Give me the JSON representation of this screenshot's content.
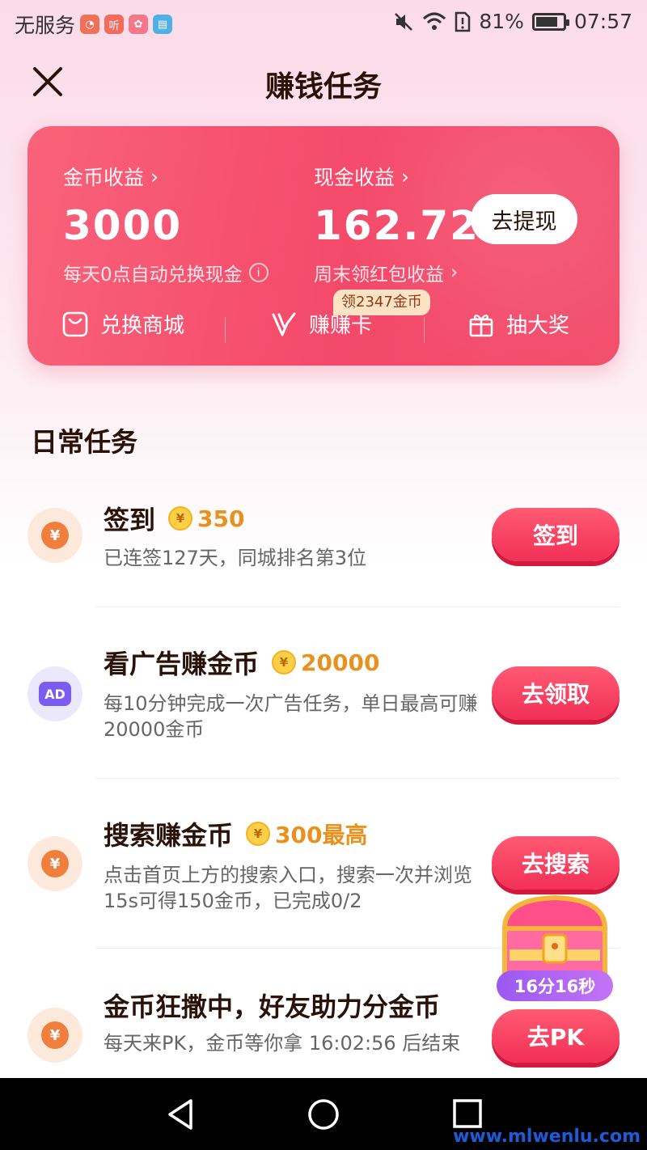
{
  "status_bar": {
    "carrier": "无服务",
    "battery": "81%",
    "battery_level": 0.81,
    "time": "07:57",
    "app_icons": [
      {
        "name": "weibo-icon",
        "color": "#f0715a",
        "glyph": "◔"
      },
      {
        "name": "listen-icon",
        "color": "#f26b5b",
        "glyph": "听"
      },
      {
        "name": "huawei-icon",
        "color": "#f2788a",
        "glyph": "✿"
      },
      {
        "name": "book-icon",
        "color": "#4fb0e6",
        "glyph": "▤"
      }
    ]
  },
  "header": {
    "title": "赚钱任务"
  },
  "earnings": {
    "coins_label": "金币收益",
    "coins_value": "3000",
    "coins_note": "每天0点自动兑换现金",
    "cash_label": "现金收益",
    "cash_value": "162.72",
    "cash_note": "周末领红包收益",
    "withdraw_label": "去提现",
    "links": [
      {
        "label": "兑换商城"
      },
      {
        "label": "赚赚卡"
      },
      {
        "label": "抽大奖"
      }
    ],
    "badge": "领2347金币"
  },
  "section": {
    "title": "日常任务"
  },
  "tasks": [
    {
      "title": "签到",
      "reward": "350",
      "desc": "已连签127天，同城排名第3位",
      "button": "签到"
    },
    {
      "title": "看广告赚金币",
      "reward": "20000",
      "desc": "每10分钟完成一次广告任务，单日最高可赚20000金币",
      "button": "去领取",
      "icon_text": "AD"
    },
    {
      "title": "搜索赚金币",
      "reward": "300最高",
      "desc": "点击首页上方的搜索入口，搜索一次并浏览15s可得150金币，已完成0/2",
      "button": "去搜索"
    },
    {
      "title": "金币狂撒中，好友助力分金币",
      "desc": "每天来PK，金币等你拿 16:02:56 后结束",
      "button": "去PK"
    }
  ],
  "chest": {
    "timer": "16分16秒"
  },
  "watermark": "www.mlwenlu.com",
  "colors": {
    "accent": "#f23057",
    "card": "#f4496a",
    "coin": "#e9911f"
  }
}
